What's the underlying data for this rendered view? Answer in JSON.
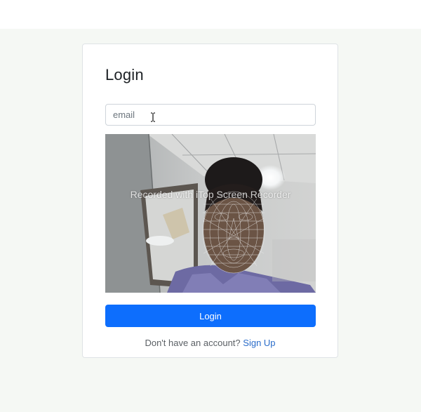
{
  "form": {
    "title": "Login",
    "email_placeholder": "email",
    "login_label": "Login",
    "signup_prompt": "Don't have an account?",
    "signup_link": "Sign Up"
  },
  "webcam": {
    "watermark": "Recorded with iTop Screen Recorder",
    "overlay": "face-mesh"
  },
  "colors": {
    "page_background": "#f5f8f4",
    "accent": "#0d6efd",
    "link": "#2a6cc9"
  }
}
